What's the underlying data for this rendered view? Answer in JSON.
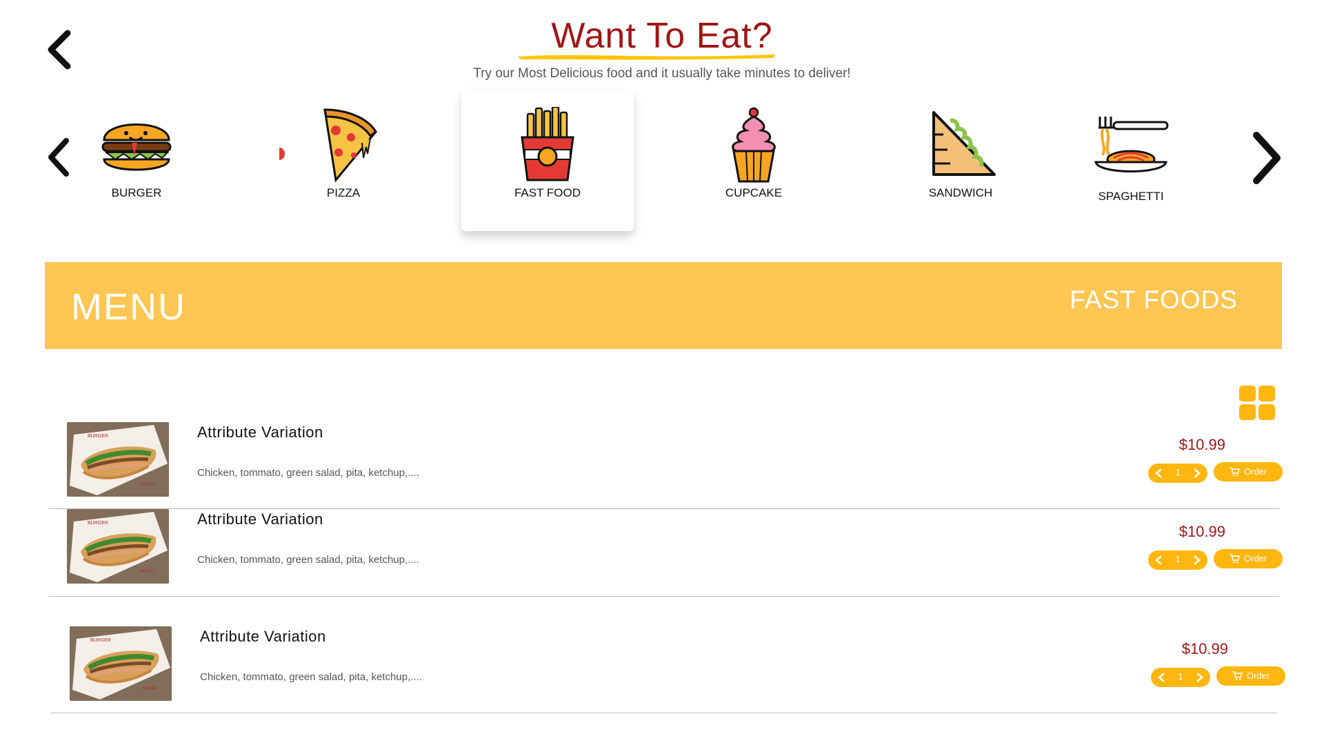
{
  "header": {
    "title": "Want To Eat?",
    "subtitle": "Try our Most Delicious food and it usually take minutes to deliver!",
    "title_color": "#a01616",
    "underline_color": "#ffc400"
  },
  "categories": [
    {
      "label": "BURGER",
      "icon": "burger-icon"
    },
    {
      "label": "PIZZA",
      "icon": "pizza-icon"
    },
    {
      "label": "FAST FOOD",
      "icon": "fries-icon",
      "active": true
    },
    {
      "label": "CUPCAKE",
      "icon": "cupcake-icon"
    },
    {
      "label": "SANDWICH",
      "icon": "sandwich-icon"
    },
    {
      "label": "SPAGHETTI",
      "icon": "spaghetti-icon"
    }
  ],
  "banner": {
    "menu_label": "MENU",
    "category_title": "FAST FOODS",
    "color": "#ffc653"
  },
  "items": [
    {
      "name": "Attribute Variation",
      "description": "Chicken, tommato, green salad, pita, ketchup,....",
      "price": "$10.99",
      "quantity": "1",
      "order_label": "Order"
    },
    {
      "name": "Attribute Variation",
      "description": "Chicken, tommato, green salad, pita, ketchup,....",
      "price": "$10.99",
      "quantity": "1",
      "order_label": "Order"
    },
    {
      "name": "Attribute Variation",
      "description": "Chicken, tommato, green salad, pita, ketchup,....",
      "price": "$10.99",
      "quantity": "1",
      "order_label": "Order"
    }
  ],
  "accent_color": "#ffb60f",
  "price_color": "#a01616"
}
